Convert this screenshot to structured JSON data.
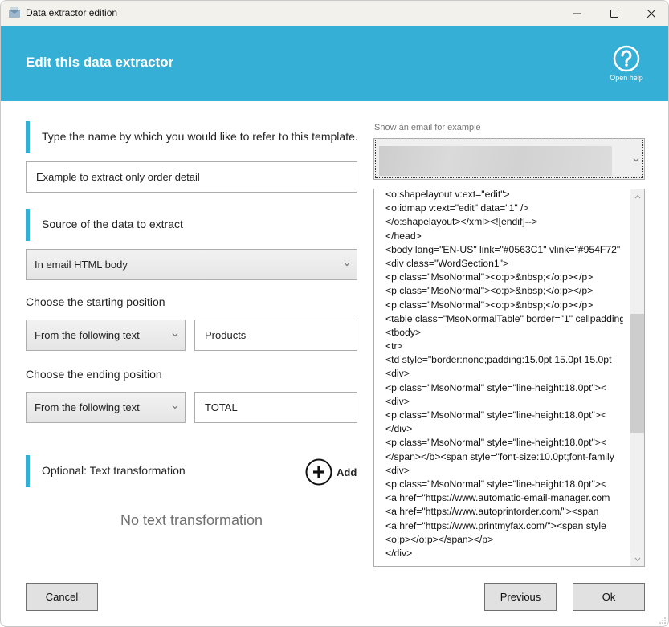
{
  "window": {
    "title": "Data extractor edition",
    "controls": {
      "minimize": "minimize",
      "maximize": "maximize",
      "close": "close"
    }
  },
  "header": {
    "title": "Edit this data extractor",
    "help_label": "Open help",
    "accent_color": "#36afd6"
  },
  "form": {
    "name_section_label": "Type the name by which you would like to refer to this template.",
    "name_value": "Example to extract only order detail",
    "source_section_label": "Source of the data to extract",
    "source_selected": "In email HTML body",
    "start_label": "Choose the starting position",
    "start_mode_selected": "From the following text",
    "start_text_value": "Products",
    "end_label": "Choose the ending position",
    "end_mode_selected": "From the following text",
    "end_text_value": "TOTAL",
    "transform_section_label": "Optional: Text transformation",
    "add_label": "Add",
    "no_transform_text": "No text transformation"
  },
  "preview": {
    "email_label": "Show an email for example",
    "email_selected": "",
    "scroll_position": 0.48,
    "scroll_visible_fraction": 0.34,
    "code_lines": [
      "<o:shapelayout v:ext=\"edit\">",
      "<o:idmap v:ext=\"edit\" data=\"1\" />",
      "</o:shapelayout></xml><![endif]-->",
      "</head>",
      "<body lang=\"EN-US\" link=\"#0563C1\" vlink=\"#954F72\"",
      "<div class=\"WordSection1\">",
      "<p class=\"MsoNormal\"><o:p>&nbsp;</o:p></p>",
      "<p class=\"MsoNormal\"><o:p>&nbsp;</o:p></p>",
      "<p class=\"MsoNormal\"><o:p>&nbsp;</o:p></p>",
      "<table class=\"MsoNormalTable\" border=\"1\" cellpadding",
      "<tbody>",
      "<tr>",
      "<td style=\"border:none;padding:15.0pt 15.0pt 15.0pt",
      "<div>",
      "<p class=\"MsoNormal\" style=\"line-height:18.0pt\"><",
      "<div>",
      "<p class=\"MsoNormal\" style=\"line-height:18.0pt\"><",
      "</div>",
      "<p class=\"MsoNormal\" style=\"line-height:18.0pt\"><",
      "</span></b><span style=\"font-size:10.0pt;font-family",
      "<div>",
      "<p class=\"MsoNormal\" style=\"line-height:18.0pt\"><",
      "<a href=\"https://www.automatic-email-manager.com",
      "<a href=\"https://www.autoprintorder.com/\"><span",
      "<a href=\"https://www.printmyfax.com/\"><span style",
      "<o:p></o:p></span></p>",
      "</div>"
    ]
  },
  "footer": {
    "cancel_label": "Cancel",
    "previous_label": "Previous",
    "ok_label": "Ok"
  }
}
